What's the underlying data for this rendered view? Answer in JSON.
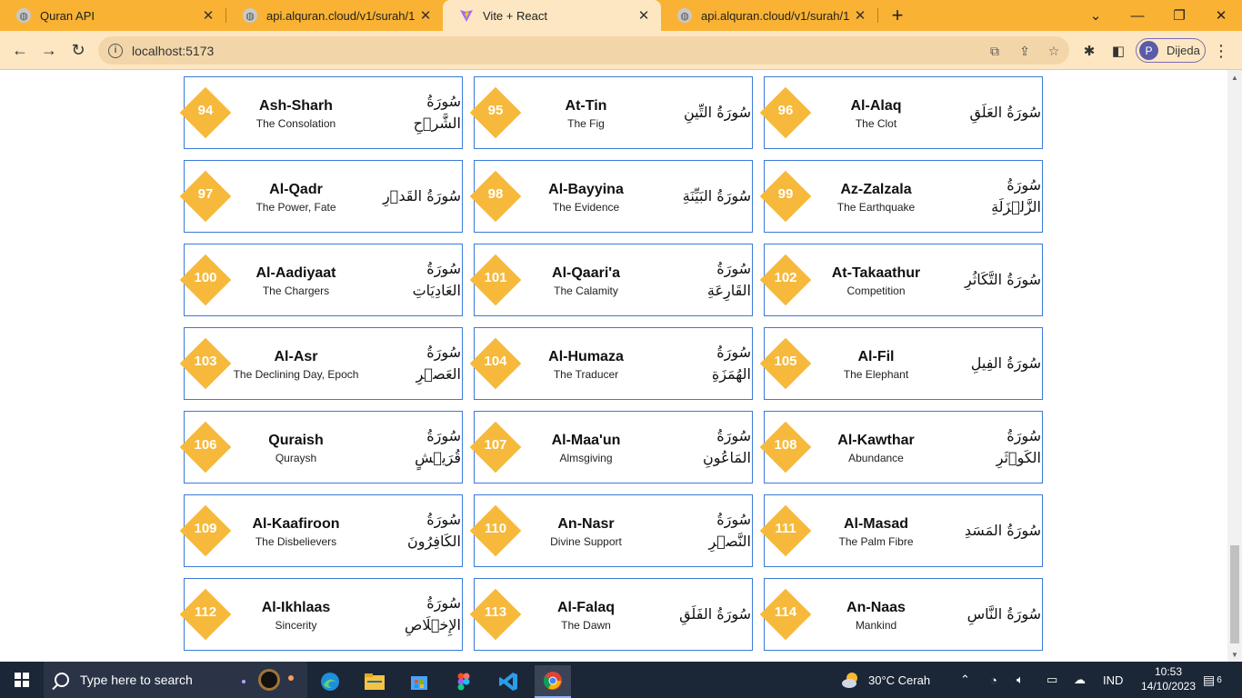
{
  "browser": {
    "tabs": [
      {
        "title": "Quran API",
        "active": false
      },
      {
        "title": "api.alquran.cloud/v1/surah/1",
        "active": false
      },
      {
        "title": "Vite + React",
        "active": true
      },
      {
        "title": "api.alquran.cloud/v1/surah/1",
        "active": false
      }
    ],
    "url": "localhost:5173",
    "profile_initial": "P",
    "profile_name": "Dijeda"
  },
  "surahs": [
    {
      "number": "94",
      "english": "Ash-Sharh",
      "translation": "The Consolation",
      "arabic": "سُورَةُ الشَّرۡحِ"
    },
    {
      "number": "95",
      "english": "At-Tin",
      "translation": "The Fig",
      "arabic": "سُورَةُ التِّينِ"
    },
    {
      "number": "96",
      "english": "Al-Alaq",
      "translation": "The Clot",
      "arabic": "سُورَةُ العَلَقِ"
    },
    {
      "number": "97",
      "english": "Al-Qadr",
      "translation": "The Power, Fate",
      "arabic": "سُورَةُ القَدۡرِ"
    },
    {
      "number": "98",
      "english": "Al-Bayyina",
      "translation": "The Evidence",
      "arabic": "سُورَةُ البَيِّنَةِ"
    },
    {
      "number": "99",
      "english": "Az-Zalzala",
      "translation": "The Earthquake",
      "arabic": "سُورَةُ الزَّلۡزَلَةِ"
    },
    {
      "number": "100",
      "english": "Al-Aadiyaat",
      "translation": "The Chargers",
      "arabic": "سُورَةُ العَادِيَاتِ"
    },
    {
      "number": "101",
      "english": "Al-Qaari'a",
      "translation": "The Calamity",
      "arabic": "سُورَةُ القَارِعَةِ"
    },
    {
      "number": "102",
      "english": "At-Takaathur",
      "translation": "Competition",
      "arabic": "سُورَةُ التَّكَاثُرِ"
    },
    {
      "number": "103",
      "english": "Al-Asr",
      "translation": "The Declining Day, Epoch",
      "arabic": "سُورَةُ العَصۡرِ"
    },
    {
      "number": "104",
      "english": "Al-Humaza",
      "translation": "The Traducer",
      "arabic": "سُورَةُ الهُمَزَةِ"
    },
    {
      "number": "105",
      "english": "Al-Fil",
      "translation": "The Elephant",
      "arabic": "سُورَةُ الفِيلِ"
    },
    {
      "number": "106",
      "english": "Quraish",
      "translation": "Quraysh",
      "arabic": "سُورَةُ قُرَيۡشٍ"
    },
    {
      "number": "107",
      "english": "Al-Maa'un",
      "translation": "Almsgiving",
      "arabic": "سُورَةُ المَاعُونِ"
    },
    {
      "number": "108",
      "english": "Al-Kawthar",
      "translation": "Abundance",
      "arabic": "سُورَةُ الكَوۡثَرِ"
    },
    {
      "number": "109",
      "english": "Al-Kaafiroon",
      "translation": "The Disbelievers",
      "arabic": "سُورَةُ الكَافِرُونَ"
    },
    {
      "number": "110",
      "english": "An-Nasr",
      "translation": "Divine Support",
      "arabic": "سُورَةُ النَّصۡرِ"
    },
    {
      "number": "111",
      "english": "Al-Masad",
      "translation": "The Palm Fibre",
      "arabic": "سُورَةُ المَسَدِ"
    },
    {
      "number": "112",
      "english": "Al-Ikhlaas",
      "translation": "Sincerity",
      "arabic": "سُورَةُ الإِخۡلَاصِ"
    },
    {
      "number": "113",
      "english": "Al-Falaq",
      "translation": "The Dawn",
      "arabic": "سُورَةُ الفَلَقِ"
    },
    {
      "number": "114",
      "english": "An-Naas",
      "translation": "Mankind",
      "arabic": "سُورَةُ النَّاسِ"
    }
  ],
  "taskbar": {
    "search_placeholder": "Type here to search",
    "weather": "30°C  Cerah",
    "language": "IND",
    "time": "10:53",
    "date": "14/10/2023",
    "notifications": "6"
  },
  "colors": {
    "accent": "#f9b233",
    "badge": "#f6b93b",
    "card_border": "#3b7ad8"
  }
}
